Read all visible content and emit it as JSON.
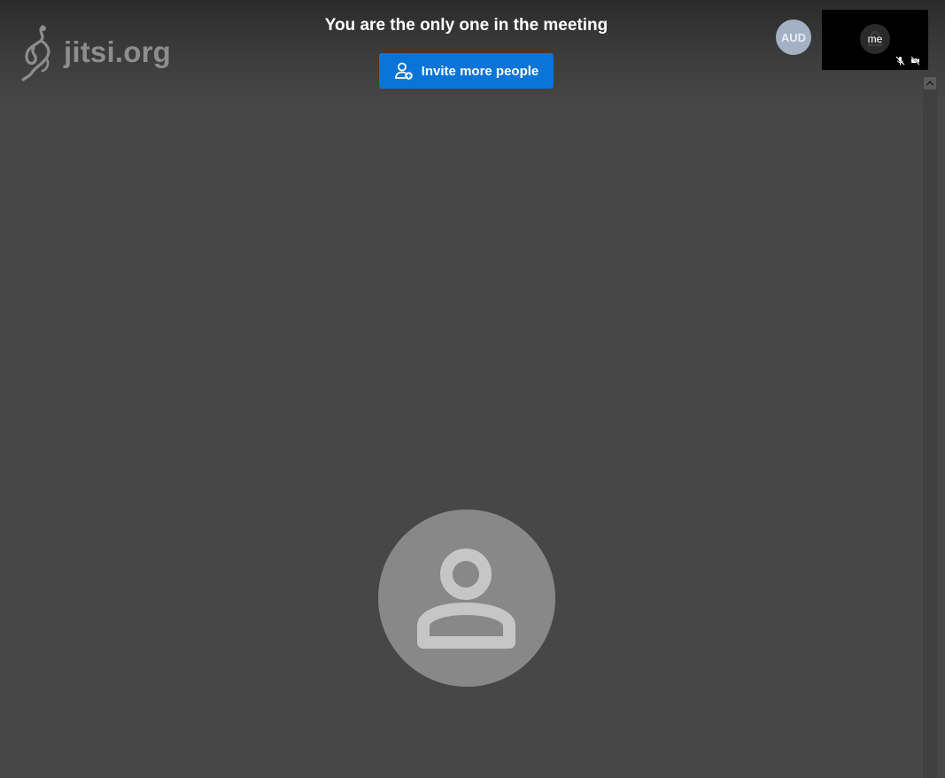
{
  "brand": {
    "logo_text": "jitsi.org",
    "logo_icon": "jitsi-logo-icon"
  },
  "notice": {
    "title": "You are the only one in the meeting",
    "invite_button_label": "Invite more people",
    "invite_icon": "add-person-icon"
  },
  "participants": {
    "remote_avatar_initials": "AUD",
    "local_label": "me",
    "local_status_icons": [
      "mic-muted-icon",
      "camera-off-icon"
    ]
  },
  "main_stage": {
    "avatar_icon": "person-icon"
  },
  "colors": {
    "background": "#474747",
    "invite_button": "#0a74d8",
    "remote_avatar": "#a4b0c4",
    "stage_avatar": "#888888"
  }
}
